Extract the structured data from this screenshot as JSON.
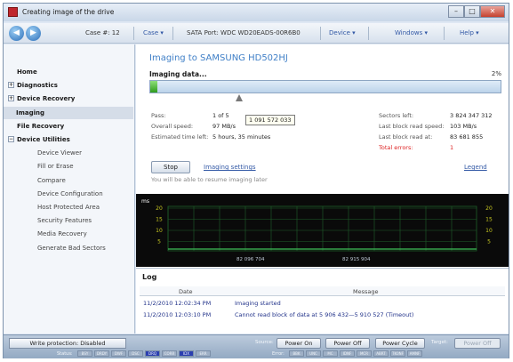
{
  "window": {
    "title": "Creating image of the drive",
    "controls": {
      "minimize": "–",
      "maximize": "□",
      "close": "✕"
    }
  },
  "toolbar": {
    "case_label": "Case #: 12",
    "case_menu": "Case ▾",
    "sata_label": "SATA Port: WDC WD20EADS-00R6B0",
    "device_menu": "Device ▾",
    "windows_menu": "Windows ▾",
    "help_menu": "Help ▾",
    "back_glyph": "◀",
    "forward_glyph": "▶"
  },
  "sidebar": {
    "items": [
      {
        "label": "Home",
        "level": 0,
        "bold": true,
        "expander": ""
      },
      {
        "label": "Diagnostics",
        "level": 0,
        "bold": true,
        "expander": "+"
      },
      {
        "label": "Device Recovery",
        "level": 0,
        "bold": true,
        "expander": "+"
      },
      {
        "label": "Imaging",
        "level": 1,
        "bold": true,
        "selected": true,
        "expander": ""
      },
      {
        "label": "File Recovery",
        "level": 0,
        "bold": true,
        "expander": ""
      },
      {
        "label": "Device Utilities",
        "level": 0,
        "bold": true,
        "expander": "−"
      },
      {
        "label": "Device Viewer",
        "level": 2,
        "bold": false,
        "expander": ""
      },
      {
        "label": "Fill or Erase",
        "level": 2,
        "bold": false,
        "expander": ""
      },
      {
        "label": "Compare",
        "level": 2,
        "bold": false,
        "expander": ""
      },
      {
        "label": "Device Configuration",
        "level": 2,
        "bold": false,
        "expander": ""
      },
      {
        "label": "Host Protected Area",
        "level": 2,
        "bold": false,
        "expander": ""
      },
      {
        "label": "Security Features",
        "level": 2,
        "bold": false,
        "expander": ""
      },
      {
        "label": "Media Recovery",
        "level": 2,
        "bold": false,
        "expander": ""
      },
      {
        "label": "Generate Bad Sectors",
        "level": 2,
        "bold": false,
        "expander": ""
      }
    ]
  },
  "main": {
    "title": "Imaging to SAMSUNG HD502HJ",
    "status": "Imaging data...",
    "percent_text": "2%",
    "progress_fraction": 0.02,
    "tooltip": "1 091 572 033",
    "stats_left": [
      {
        "label": "Pass:",
        "value": "1 of 5"
      },
      {
        "label": "Overall speed:",
        "value": "97 MB/s"
      },
      {
        "label": "Estimated time left:",
        "value": "5 hours, 35 minutes"
      }
    ],
    "stats_right": [
      {
        "label": "Sectors left:",
        "value": "3 824 347 312",
        "red": false
      },
      {
        "label": "Last block read speed:",
        "value": "103 MB/s",
        "red": false
      },
      {
        "label": "Last block read at:",
        "value": "83 681 855",
        "red": false
      },
      {
        "label": "Total errors:",
        "value": "1",
        "red": true
      }
    ],
    "stop_button": "Stop",
    "imaging_settings_link": "Imaging settings",
    "legend_link": "Legend",
    "resume_hint": "You will be able to resume imaging later"
  },
  "graph": {
    "unit": "ms",
    "y_ticks": [
      "20",
      "15",
      "10",
      "5"
    ],
    "x_labels": [
      "82 096 704",
      "82 915 904"
    ],
    "colors": {
      "background": "#0a0a0a",
      "grid": "#1f5f2a",
      "line": "#3fbf58",
      "ticks": "#c8c820"
    }
  },
  "log": {
    "title": "Log",
    "columns": [
      "Date",
      "Message"
    ],
    "rows": [
      {
        "date": "11/2/2010 12:02:34 PM",
        "message": "Imaging started"
      },
      {
        "date": "11/2/2010 12:03:10 PM",
        "message": "Cannot read block of data at 5 906 432—5 910 527 (Timeout)"
      }
    ]
  },
  "bottom": {
    "write_protection": "Write protection: Disabled",
    "source_label": "Source:",
    "target_label": "Target:",
    "buttons": {
      "power_on": "Power On",
      "power_off": "Power Off",
      "power_cycle": "Power Cycle",
      "target_power_off": "Power Off"
    },
    "status_label": "Status:",
    "error_label": "Error:",
    "status_indicators": [
      {
        "label": "BSY",
        "on": false
      },
      {
        "label": "DRDY",
        "on": false
      },
      {
        "label": "DWF",
        "on": false
      },
      {
        "label": "DSC",
        "on": false
      },
      {
        "label": "DRQ",
        "on": true
      },
      {
        "label": "CORR",
        "on": false
      },
      {
        "label": "IDX",
        "on": true
      },
      {
        "label": "ERR",
        "on": false
      }
    ],
    "error_indicators": [
      {
        "label": "BBK",
        "on": false
      },
      {
        "label": "UNC",
        "on": false
      },
      {
        "label": "MC",
        "on": false
      },
      {
        "label": "IDNF",
        "on": false
      },
      {
        "label": "MCR",
        "on": false
      },
      {
        "label": "ABRT",
        "on": false
      },
      {
        "label": "TK0NF",
        "on": false
      },
      {
        "label": "AMNF",
        "on": false
      }
    ]
  }
}
